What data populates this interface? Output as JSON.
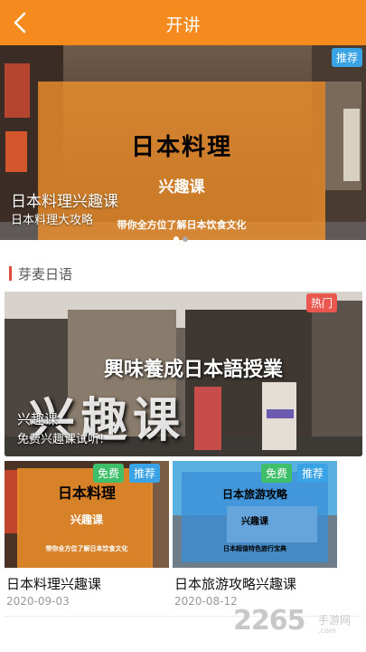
{
  "header": {
    "title": "开讲",
    "bg_color": "#f58a1f"
  },
  "banner": {
    "badge": "推荐",
    "poster_line1": "日本料理",
    "poster_line2": "兴趣课",
    "poster_line3": "带你全方位了解日本饮食文化",
    "title": "日本料理兴趣课",
    "subtitle": "日本料理大攻略",
    "slides": 2,
    "active_slide": 1
  },
  "section": {
    "title": "芽麦日语",
    "accent_color": "#e24a3b"
  },
  "featured": {
    "badge": "热门",
    "poster_line1": "興味養成日本語授業",
    "poster_line2": "兴趣课",
    "title": "兴趣课",
    "subtitle": "免费兴趣课试听!"
  },
  "courses": [
    {
      "badge_free": "免费",
      "badge_rec": "推荐",
      "poster_line1": "日本料理",
      "poster_line2": "兴趣课",
      "poster_line3": "带你全方位了解日本饮食文化",
      "title": "日本料理兴趣课",
      "date": "2020-09-03"
    },
    {
      "badge_free": "免费",
      "badge_rec": "推荐",
      "poster_line1": "日本旅游攻略",
      "poster_line2": "兴趣课",
      "poster_line3": "日本超值特色旅行宝典",
      "title": "日本旅游攻略兴趣课",
      "date": "2020-08-12"
    }
  ],
  "watermark": {
    "number": "2265",
    "suffix": ".com",
    "name": "手游网"
  }
}
